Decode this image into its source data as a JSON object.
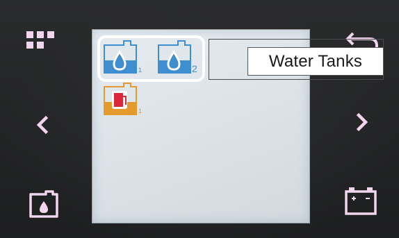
{
  "callout": {
    "label": "Water Tanks"
  },
  "tanks": [
    {
      "name": "water-tank-1",
      "index_label": "1",
      "color": "#3f8fd0"
    },
    {
      "name": "water-tank-2",
      "index_label": "2",
      "color": "#3f8fd0"
    },
    {
      "name": "fuel-tank",
      "index_label": "1",
      "color": "#e49a2c"
    }
  ],
  "buttons": {
    "top_left": "grid-menu-icon",
    "top_right": "back-arrow-icon",
    "middle_left": "chevron-left-icon",
    "middle_right": "chevron-right-icon",
    "bottom_left": "water-tank-icon",
    "bottom_right": "battery-icon"
  },
  "colors": {
    "button_glow": "#f2d6ee",
    "selection": "#ffffff",
    "water_blue": "#3f8fd0",
    "fuel_orange": "#e49a2c",
    "fuel_red": "#d8283a"
  }
}
